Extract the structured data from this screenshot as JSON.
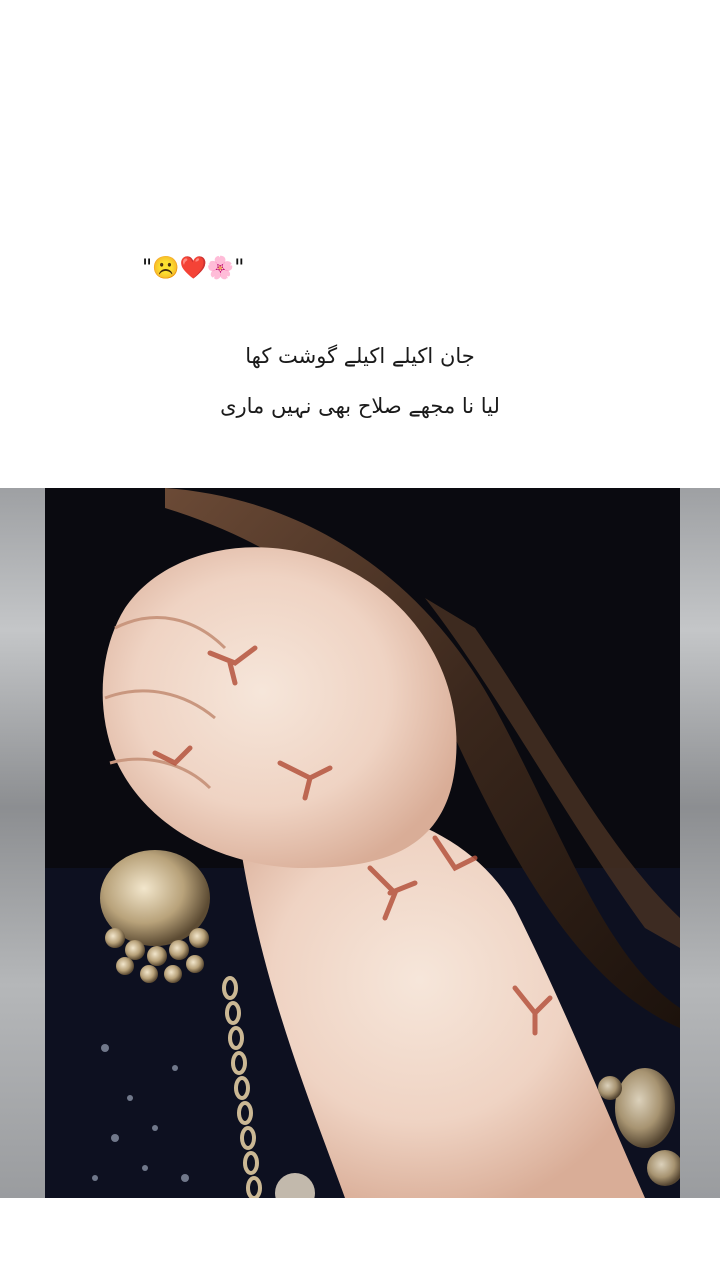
{
  "post": {
    "caption_emojis": "\"☹️❤️🌸\"",
    "poem_line_1": "جان اکیلے اکیلے گوشت کھا",
    "poem_line_2": "لیا نا مجھے صلاح بھی نہیں ماری"
  },
  "image": {
    "icon": "photo-hand-henna-jhumka"
  }
}
